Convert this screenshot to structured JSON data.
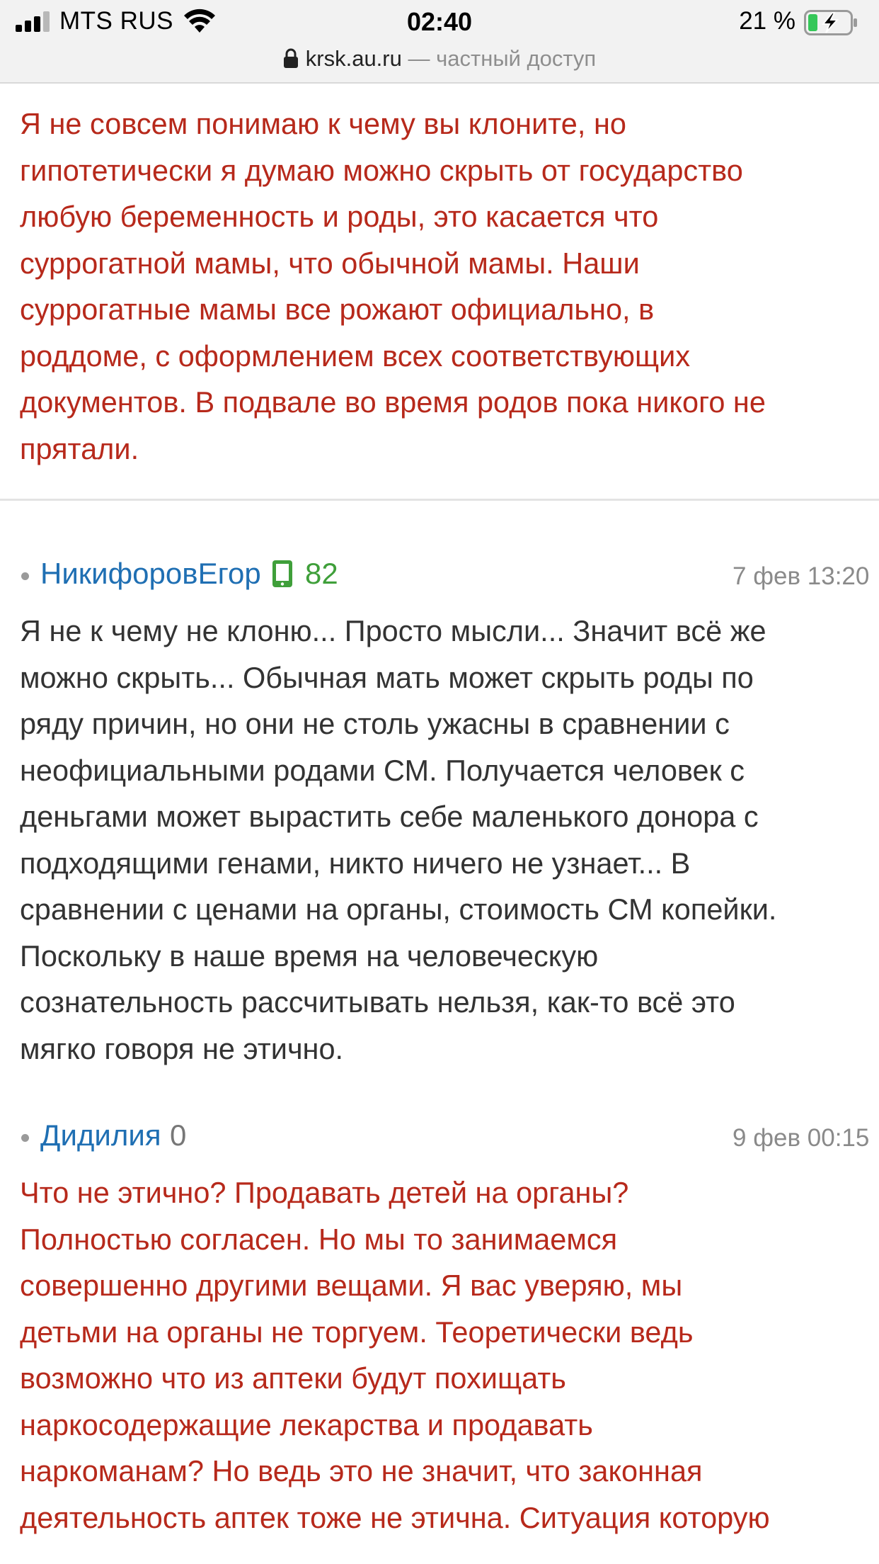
{
  "status_bar": {
    "carrier": "MTS RUS",
    "time": "02:40",
    "battery_percent": "21 %",
    "battery_level": 0.21,
    "signal_bars_filled": 3,
    "signal_bars_total": 4
  },
  "url_bar": {
    "domain": "krsk.au.ru",
    "separator": "—",
    "access_label": "частный доступ",
    "icon": "lock-icon"
  },
  "colors": {
    "reply_text": "#b7291b",
    "comment_text": "#333333",
    "author_link": "#1f6fb3",
    "rating_positive": "#3f9f3a",
    "rating_neutral": "#777777",
    "date": "#8a8a8a",
    "battery_fill": "#35c759"
  },
  "top_reply": {
    "lines": [
      "Я не совсем понимаю к чему вы клоните, но",
      "гипотетически я думаю можно скрыть от государство",
      "любую беременность и роды, это касается что",
      "суррогатной мамы, что обычной мамы. Наши",
      "суррогатные мамы все рожают официально, в",
      "роддоме, с оформлением всех соответствующих",
      "документов. В подвале во время родов пока никого не",
      "прятали."
    ]
  },
  "comments": [
    {
      "author": "НикифоровЕгор",
      "rating": "82",
      "rating_icon": "mobile-phone-icon",
      "date": "7 фев 13:20",
      "style": "user",
      "lines": [
        "Я не к чему не клоню... Просто мысли... Значит всё же",
        "можно скрыть... Обычная мать может скрыть роды по",
        "ряду причин, но они не столь ужасны в сравнении с",
        "неофициальными родами СМ. Получается человек с",
        "деньгами может вырастить себе маленького донора с",
        "подходящими генами, никто ничего не узнает... В",
        "сравнении с ценами на органы, стоимость СМ копейки.",
        "Поскольку в наше время на человеческую",
        "сознательность рассчитывать нельзя, как-то всё это",
        "мягко говоря не этично."
      ]
    },
    {
      "author": "Дидилия",
      "rating": "0",
      "date": "9 фев 00:15",
      "style": "reply",
      "lines": [
        "Что не этично? Продавать детей на органы?",
        "Полностью согласен. Но мы то занимаемся",
        "совершенно другими вещами. Я вас уверяю, мы",
        "детьми на органы не торгуем. Теоретически ведь",
        "возможно что из аптеки будут похищать",
        "наркосодержащие лекарства и продавать",
        "наркоманам? Но ведь это не значит, что законная",
        "деятельность аптек тоже не этична. Ситуация которую"
      ]
    }
  ]
}
